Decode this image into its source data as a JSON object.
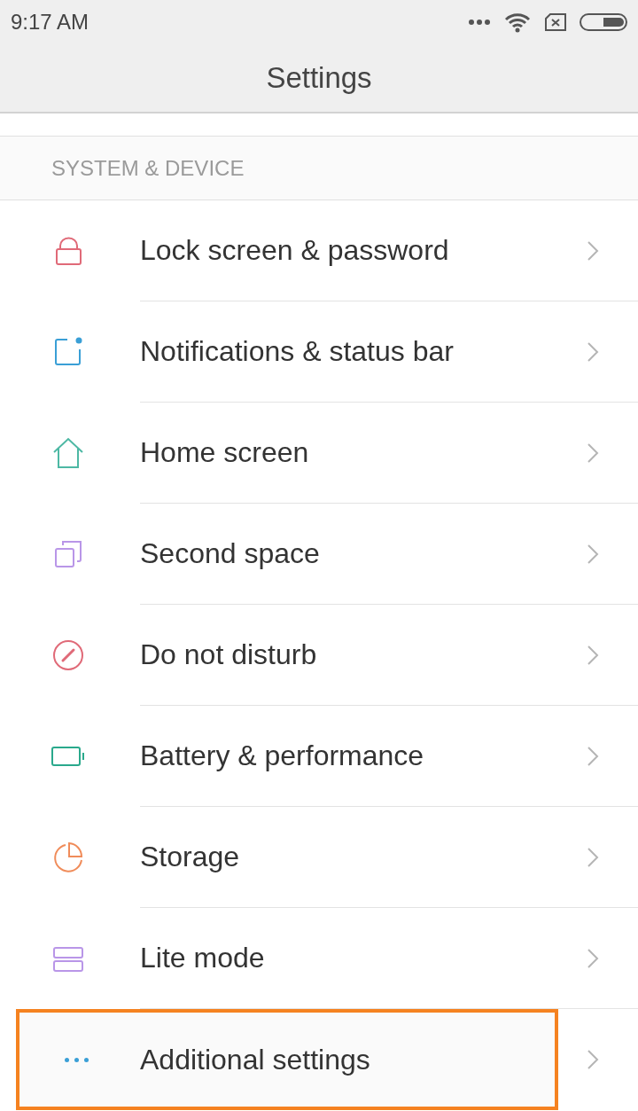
{
  "status_bar": {
    "time": "9:17  AM"
  },
  "header": {
    "title": "Settings"
  },
  "section": {
    "title": "SYSTEM & DEVICE"
  },
  "items": [
    {
      "label": "Lock screen & password",
      "kind": "lock",
      "color": "#e06a78",
      "highlighted": false
    },
    {
      "label": "Notifications & status bar",
      "kind": "notification",
      "color": "#3a9fd6",
      "highlighted": false
    },
    {
      "label": "Home screen",
      "kind": "home",
      "color": "#4db8a4",
      "highlighted": false
    },
    {
      "label": "Second space",
      "kind": "copies",
      "color": "#b996e8",
      "highlighted": false
    },
    {
      "label": "Do not disturb",
      "kind": "dnd",
      "color": "#e06a78",
      "highlighted": false
    },
    {
      "label": "Battery & performance",
      "kind": "battery",
      "color": "#2aa98c",
      "highlighted": false
    },
    {
      "label": "Storage",
      "kind": "pie",
      "color": "#f08c5a",
      "highlighted": false
    },
    {
      "label": "Lite mode",
      "kind": "stack",
      "color": "#b996e8",
      "highlighted": false
    },
    {
      "label": "Additional settings",
      "kind": "dots",
      "color": "#3a9fd6",
      "highlighted": true
    }
  ]
}
